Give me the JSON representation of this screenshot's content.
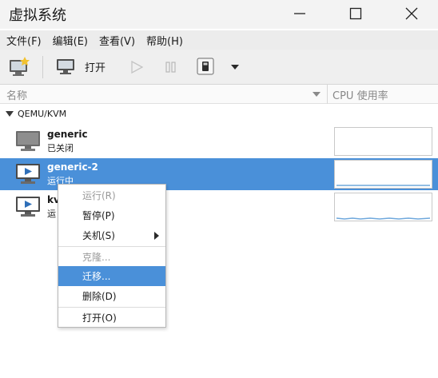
{
  "window": {
    "title": "虚拟系统"
  },
  "menubar": {
    "items": [
      "文件(F)",
      "编辑(E)",
      "查看(V)",
      "帮助(H)"
    ]
  },
  "toolbar": {
    "open_label": "打开"
  },
  "columns": {
    "name": "名称",
    "cpu": "CPU 使用率"
  },
  "tree": {
    "group_label": "QEMU/KVM",
    "vms": [
      {
        "name": "generic",
        "status": "已关闭"
      },
      {
        "name": "generic-2",
        "status": "运行中"
      },
      {
        "name": "kv",
        "status": "运"
      }
    ]
  },
  "context_menu": {
    "items": [
      {
        "label": "运行(R)"
      },
      {
        "label": "暂停(P)"
      },
      {
        "label": "关机(S)"
      },
      {
        "label": "克隆..."
      },
      {
        "label": "迁移..."
      },
      {
        "label": "删除(D)"
      },
      {
        "label": "打开(O)"
      }
    ]
  },
  "colors": {
    "selection": "#4a90d9",
    "graph_line": "#6fa8dc"
  },
  "icons": [
    "new-vm-icon",
    "monitor-icon",
    "play-icon",
    "pause-icon",
    "console-icon",
    "dropdown-icon",
    "minimize-icon",
    "maximize-icon",
    "close-icon"
  ]
}
